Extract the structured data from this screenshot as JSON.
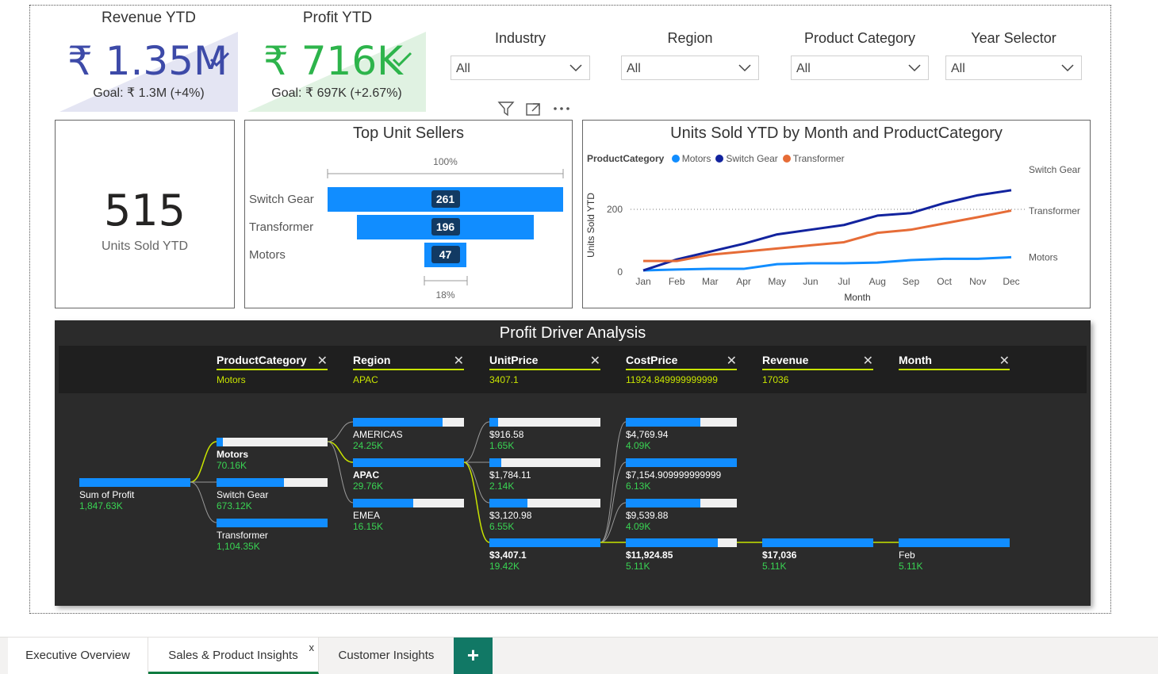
{
  "kpis": {
    "revenue": {
      "title": "Revenue YTD",
      "value": "₹ 1.35M",
      "goal": "Goal: ₹ 1.3M (+4%)",
      "color": "#3D4AA8",
      "bg": "#E4E5F3"
    },
    "profit": {
      "title": "Profit YTD",
      "value": "₹ 716K",
      "goal": "Goal: ₹ 697K (+2.67%)",
      "color": "#2DB44B",
      "bg": "#E0F2E2"
    }
  },
  "slicers": [
    {
      "title": "Industry",
      "value": "All"
    },
    {
      "title": "Region",
      "value": "All"
    },
    {
      "title": "Product Category",
      "value": "All"
    },
    {
      "title": "Year Selector",
      "value": "All"
    }
  ],
  "units_card": {
    "value": "515",
    "label": "Units Sold YTD"
  },
  "funnel": {
    "title": "Top Unit Sellers",
    "top_pct": "100%",
    "bottom_pct": "18%",
    "items": [
      {
        "label": "Switch Gear",
        "value": 261
      },
      {
        "label": "Transformer",
        "value": 196
      },
      {
        "label": "Motors",
        "value": 47
      }
    ]
  },
  "chart_data": {
    "type": "line",
    "title": "Units Sold YTD by Month and ProductCategory",
    "legend_title": "ProductCategory",
    "xlabel": "Month",
    "ylabel": "Units Sold YTD",
    "categories": [
      "Jan",
      "Feb",
      "Mar",
      "Apr",
      "May",
      "Jun",
      "Jul",
      "Aug",
      "Sep",
      "Oct",
      "Nov",
      "Dec"
    ],
    "yticks": [
      0,
      200
    ],
    "ylim": [
      0,
      260
    ],
    "reference_line": 200,
    "legend_position": "top-left",
    "series": [
      {
        "name": "Motors",
        "color": "#118DFF",
        "values": [
          5,
          8,
          10,
          10,
          25,
          28,
          28,
          30,
          38,
          42,
          42,
          47
        ]
      },
      {
        "name": "Switch Gear",
        "color": "#12239E",
        "values": [
          5,
          40,
          65,
          90,
          120,
          135,
          150,
          180,
          188,
          220,
          245,
          261
        ]
      },
      {
        "name": "Transformer",
        "color": "#E66C37",
        "values": [
          35,
          35,
          55,
          65,
          75,
          85,
          95,
          125,
          135,
          155,
          175,
          196
        ]
      }
    ]
  },
  "decomp": {
    "title": "Profit Driver Analysis",
    "columns": [
      {
        "header": "ProductCategory",
        "selected": "Motors"
      },
      {
        "header": "Region",
        "selected": "APAC"
      },
      {
        "header": "UnitPrice",
        "selected": "3407.1"
      },
      {
        "header": "CostPrice",
        "selected": "11924.849999999999"
      },
      {
        "header": "Revenue",
        "selected": "17036"
      },
      {
        "header": "Month",
        "selected": ""
      }
    ],
    "root": {
      "name": "Sum of Profit",
      "value": "1,847.63K",
      "fill": 1.0
    },
    "levels": [
      [
        {
          "name": "Motors",
          "value": "70.16K",
          "fill": 0.06,
          "bold": true
        },
        {
          "name": "Switch Gear",
          "value": "673.12K",
          "fill": 0.61
        },
        {
          "name": "Transformer",
          "value": "1,104.35K",
          "fill": 1.0
        }
      ],
      [
        {
          "name": "AMERICAS",
          "value": "24.25K",
          "fill": 0.81
        },
        {
          "name": "APAC",
          "value": "29.76K",
          "fill": 1.0,
          "bold": true
        },
        {
          "name": "EMEA",
          "value": "16.15K",
          "fill": 0.54
        }
      ],
      [
        {
          "name": "$916.58",
          "value": "1.65K",
          "fill": 0.08
        },
        {
          "name": "$1,784.11",
          "value": "2.14K",
          "fill": 0.11
        },
        {
          "name": "$3,120.98",
          "value": "6.55K",
          "fill": 0.34
        },
        {
          "name": "$3,407.1",
          "value": "19.42K",
          "fill": 1.0,
          "bold": true
        }
      ],
      [
        {
          "name": "$4,769.94",
          "value": "4.09K",
          "fill": 0.67
        },
        {
          "name": "$7,154.909999999999",
          "value": "6.13K",
          "fill": 1.0
        },
        {
          "name": "$9,539.88",
          "value": "4.09K",
          "fill": 0.67
        },
        {
          "name": "$11,924.85",
          "value": "5.11K",
          "fill": 0.83,
          "bold": true
        }
      ],
      [
        {
          "name": "$17,036",
          "value": "5.11K",
          "fill": 1.0,
          "bold": true
        }
      ],
      [
        {
          "name": "Feb",
          "value": "5.11K",
          "fill": 1.0
        }
      ]
    ]
  },
  "tabs": [
    {
      "label": "Executive Overview",
      "active": false
    },
    {
      "label": "Sales & Product Insights",
      "active": true,
      "close": "x"
    },
    {
      "label": "Customer Insights",
      "active": false
    }
  ],
  "add_tab": "+"
}
